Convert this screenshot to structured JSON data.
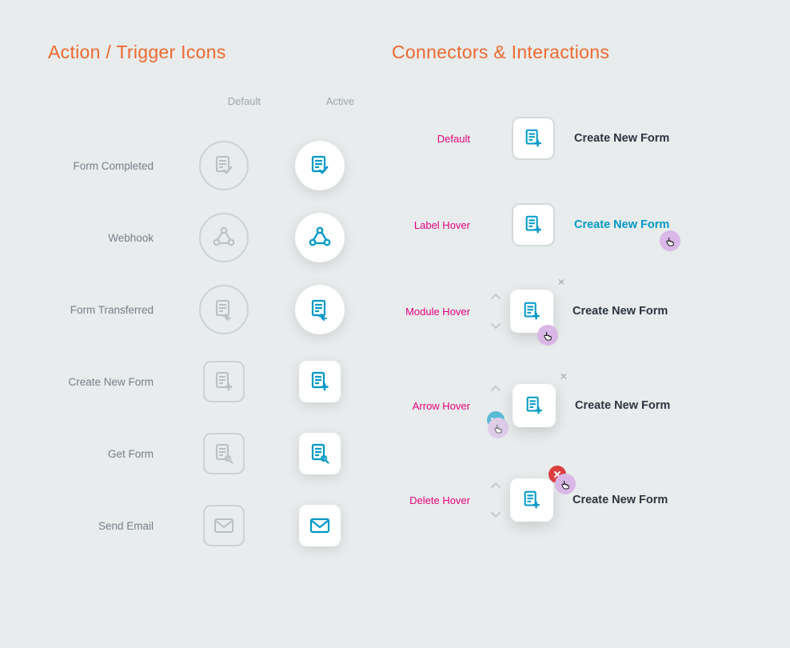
{
  "left": {
    "title": "Action / Trigger Icons",
    "col_default": "Default",
    "col_active": "Active",
    "rows": [
      {
        "label": "Form Completed"
      },
      {
        "label": "Webhook"
      },
      {
        "label": "Form Transferred"
      },
      {
        "label": "Create New Form"
      },
      {
        "label": "Get Form"
      },
      {
        "label": "Send Email"
      }
    ]
  },
  "right": {
    "title": "Connectors & Interactions",
    "states": [
      {
        "label": "Default",
        "module_label": "Create New Form"
      },
      {
        "label": "Label Hover",
        "module_label": "Create New Form"
      },
      {
        "label": "Module Hover",
        "module_label": "Create New Form"
      },
      {
        "label": "Arrow Hover",
        "module_label": "Create New Form"
      },
      {
        "label": "Delete Hover",
        "module_label": "Create New Form"
      }
    ]
  },
  "colors": {
    "accent": "#f0682e",
    "magenta": "#e6007e",
    "blue": "#0099c8",
    "gray": "#aeb6ba",
    "red": "#dd3e3e"
  }
}
